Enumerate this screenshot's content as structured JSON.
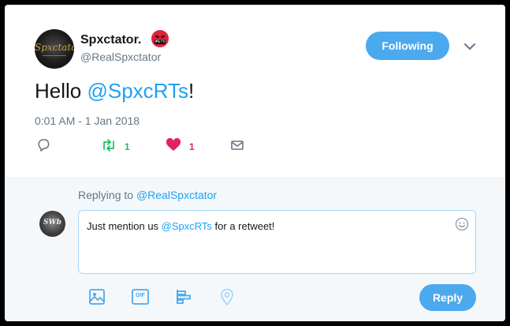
{
  "tweet": {
    "author": {
      "display_name": "Spxctator.",
      "handle": "@RealSpxctator",
      "avatar_logo_text": "Spxctator",
      "emoji_icon": "angry-face-emoji-icon"
    },
    "follow_button_label": "Following",
    "text_prefix": "Hello ",
    "text_mention": "@SpxcRTs",
    "text_suffix": "!",
    "timestamp": "0:01 AM - 1 Jan 2018",
    "actions": {
      "reply_icon": "reply-icon",
      "retweet_icon": "retweet-icon",
      "retweet_count": "1",
      "like_icon": "heart-icon",
      "like_count": "1",
      "message_icon": "envelope-icon"
    }
  },
  "reply": {
    "replying_prefix": "Replying to ",
    "replying_handle": "@RealSpxctator",
    "avatar_text": "SWb",
    "compose_prefix": "Just mention us ",
    "compose_mention": "@SpxcRTs",
    "compose_suffix": " for a retweet!",
    "tools": [
      "image-icon",
      "gif-icon",
      "poll-icon",
      "location-icon"
    ],
    "gif_label": "GIF",
    "reply_button_label": "Reply"
  },
  "colors": {
    "accent": "#4ba9ee",
    "mention": "#1da1f2",
    "retweet": "#17bf63",
    "like": "#e0245e",
    "muted": "#657786"
  }
}
